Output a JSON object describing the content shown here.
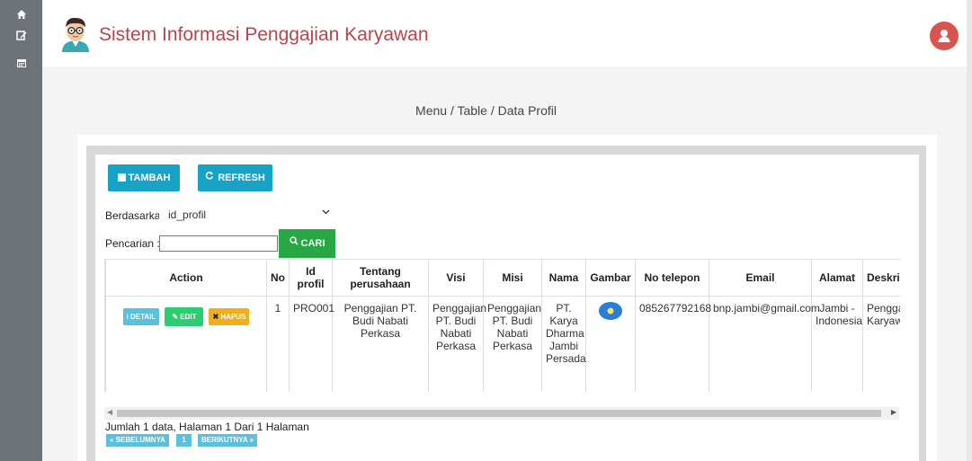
{
  "header": {
    "title": "Sistem Informasi Penggajian Karyawan"
  },
  "sidebar": {
    "icons": [
      "home-icon",
      "edit-icon",
      "calendar-icon"
    ]
  },
  "breadcrumb": "Menu / Table / Data Profil",
  "toolbar": {
    "add_label": "TAMBAH",
    "refresh_label": "REFRESH"
  },
  "filter": {
    "by_label": "Berdasarkan:",
    "by_value": "id_profil",
    "search_label": "Pencarian :",
    "search_value": "",
    "search_button": "CARI"
  },
  "table": {
    "headers": [
      "Action",
      "No",
      "Id profil",
      "Tentang perusahaan",
      "Visi",
      "Misi",
      "Nama",
      "Gambar",
      "No telepon",
      "Email",
      "Alamat",
      "Deskrips"
    ],
    "actions": [
      "DETAIL",
      "EDIT",
      "HAPUS"
    ],
    "rows": [
      {
        "no": "1",
        "id_profil": "PRO001",
        "tentang": "Penggajian PT. Budi Nabati Perkasa",
        "visi": "Penggajian PT. Budi Nabati Perkasa",
        "misi": "Penggajian PT. Budi Nabati Perkasa",
        "nama": "PT. Karya Dharma Jambi Persada",
        "no_telepon": "085267792168",
        "email": "bnp.jambi@gmail.com",
        "alamat": "Jambi - Indonesia",
        "deskripsi": "Penggajian Karyawan"
      }
    ]
  },
  "pagination": {
    "summary": "Jumlah 1 data, Halaman 1 Dari 1 Halaman",
    "prev": "« SEBELUMNYA",
    "page": "1",
    "next": "BERIKUTNYA »"
  },
  "colors": {
    "sidebar": "#6d7378",
    "title": "#b5474c",
    "primary": "#17a2c6",
    "success": "#28a745",
    "warning": "#f0ad1c",
    "danger": "#d9534f"
  }
}
